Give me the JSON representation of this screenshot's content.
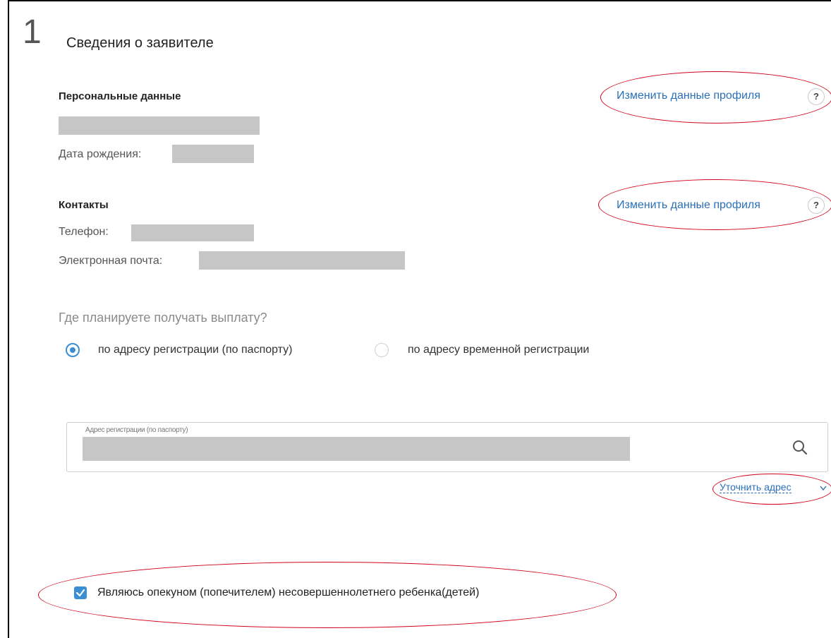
{
  "step": {
    "number": "1",
    "title": "Сведения о заявителе"
  },
  "personal": {
    "heading": "Персональные данные",
    "edit_link": "Изменить данные профиля",
    "help": "?",
    "birth_label": "Дата рождения:"
  },
  "contacts": {
    "heading": "Контакты",
    "edit_link": "Изменить данные профиля",
    "help": "?",
    "phone_label": "Телефон:",
    "email_label": "Электронная почта:"
  },
  "payment": {
    "question": "Где планируете получать выплату?",
    "options": [
      {
        "label": "по адресу регистрации (по паспорту)",
        "selected": true
      },
      {
        "label": "по адресу временной регистрации",
        "selected": false
      }
    ]
  },
  "address": {
    "field_label": "Адрес регистрации (по паспорту)",
    "icon": "search-icon",
    "refine_link": "Уточнить адрес"
  },
  "guardian": {
    "label": "Являюсь опекуном (попечителем) несовершеннолетнего ребенка(детей)",
    "checked": true
  },
  "colors": {
    "link": "#2a6fb8",
    "accent": "#3a8fd4",
    "annotation": "#d0021b",
    "redaction": "#c6c6c6"
  }
}
